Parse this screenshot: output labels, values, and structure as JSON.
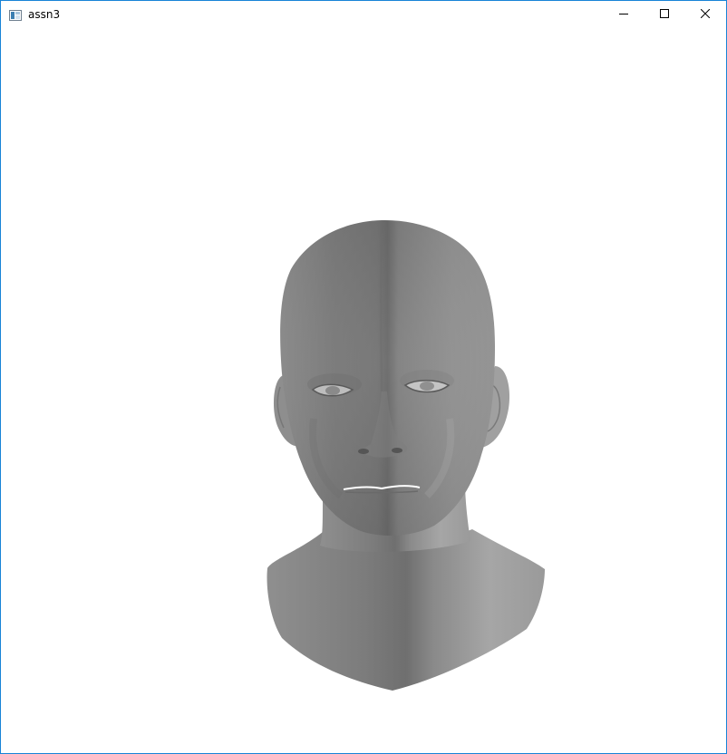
{
  "window": {
    "title": "assn3",
    "border_color": "#1883d7",
    "background": "#ffffff"
  },
  "titlebar": {
    "icons": {
      "app": "app-window-icon",
      "minimize": "minimize-icon",
      "maximize": "maximize-icon",
      "close": "close-icon"
    }
  },
  "viewport": {
    "content": "3d-head-model",
    "shading_color": "#8c8c8c"
  }
}
